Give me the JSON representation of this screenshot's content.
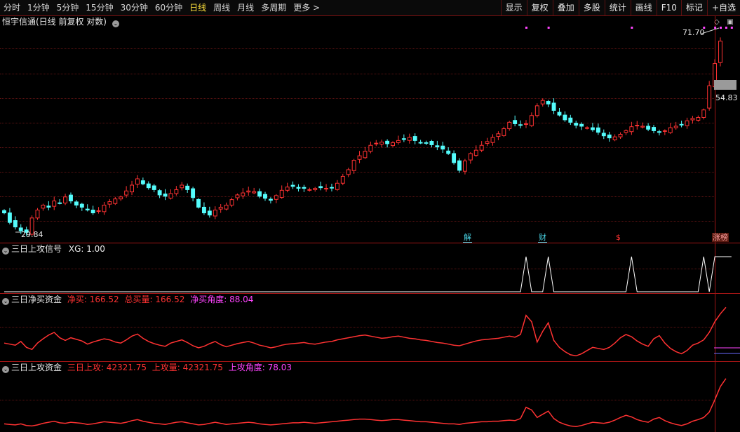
{
  "toolbar": {
    "periods": [
      {
        "label": "分时",
        "active": false
      },
      {
        "label": "1分钟",
        "active": false
      },
      {
        "label": "5分钟",
        "active": false
      },
      {
        "label": "15分钟",
        "active": false
      },
      {
        "label": "30分钟",
        "active": false
      },
      {
        "label": "60分钟",
        "active": false
      },
      {
        "label": "日线",
        "active": true
      },
      {
        "label": "周线",
        "active": false
      },
      {
        "label": "月线",
        "active": false
      },
      {
        "label": "多周期",
        "active": false
      },
      {
        "label": "更多 >",
        "active": false
      }
    ],
    "tools": [
      "显示",
      "复权",
      "叠加",
      "多股",
      "统计",
      "画线",
      "F10",
      "标记",
      "+自选"
    ]
  },
  "main": {
    "title": "恒宇信通(日线 前复权 对数)",
    "high_label": "71.70",
    "low_label": "29.84",
    "last_price": "54.83",
    "event_badges": [
      {
        "text": "解",
        "color": "#48d0e0"
      },
      {
        "text": "财",
        "color": "#48d0e0"
      },
      {
        "text": "$",
        "color": "#ff3232"
      },
      {
        "text": "涨榜",
        "color": "#ffa0a0"
      }
    ]
  },
  "panel1": {
    "name": "三日上攻信号",
    "items": [
      {
        "label": "XG: 1.00",
        "color": "#e8e8e8"
      }
    ]
  },
  "panel2": {
    "name": "三日净买资金",
    "items": [
      {
        "label": "净买: 166.52",
        "color": "#ff3232"
      },
      {
        "label": "总买量: 166.52",
        "color": "#ff3232"
      },
      {
        "label": "净买角度: 88.04",
        "color": "#ff44ff"
      }
    ]
  },
  "panel3": {
    "name": "三日上攻资金",
    "items": [
      {
        "label": "三日上攻: 42321.75",
        "color": "#ff3232"
      },
      {
        "label": "上攻量: 42321.75",
        "color": "#ff3232"
      },
      {
        "label": "上攻角度: 78.03",
        "color": "#ff44ff"
      }
    ]
  },
  "colors": {
    "up": "#ff3232",
    "down": "#54fcfc",
    "grid": "#5a1212",
    "signal": "#ffffff",
    "marker": "#ff44ff"
  },
  "chart_data": {
    "type": "candlestick",
    "closes": [
      32.5,
      31.2,
      30.6,
      30.1,
      29.9,
      31.8,
      32.9,
      33.6,
      33.3,
      34.2,
      33.9,
      34.8,
      34.2,
      33.6,
      33.3,
      32.9,
      32.5,
      32.8,
      33.6,
      34.1,
      34.5,
      34.8,
      35.7,
      36.6,
      37.6,
      36.8,
      36.2,
      35.9,
      35.1,
      34.9,
      35.3,
      35.9,
      36.6,
      35.9,
      34.7,
      33.3,
      32.5,
      32.2,
      32.9,
      33.3,
      33.6,
      34.4,
      35.1,
      35.4,
      35.7,
      35.6,
      34.9,
      34.6,
      34.3,
      35.0,
      35.8,
      36.3,
      36.4,
      36.1,
      36.1,
      35.9,
      36.1,
      36.2,
      36.1,
      36.2,
      36.9,
      38.0,
      39.1,
      40.7,
      41.5,
      42.3,
      43.4,
      43.8,
      44.0,
      43.7,
      43.9,
      44.3,
      44.5,
      44.9,
      44.3,
      43.9,
      43.8,
      43.5,
      43.1,
      42.7,
      41.9,
      40.3,
      39.0,
      40.6,
      41.9,
      42.5,
      43.4,
      44.1,
      44.9,
      45.6,
      46.6,
      47.9,
      47.6,
      47.3,
      47.6,
      49.3,
      51.4,
      52.6,
      51.8,
      50.4,
      49.4,
      48.4,
      47.9,
      47.3,
      47.1,
      46.8,
      46.4,
      45.9,
      45.2,
      44.8,
      45.0,
      45.5,
      46.2,
      47.0,
      47.3,
      47.1,
      46.5,
      46.2,
      45.9,
      46.2,
      46.8,
      47.1,
      47.4,
      48.2,
      48.7,
      48.9,
      50.5,
      56.0,
      61.6,
      67.8
    ],
    "ylim": [
      29.84,
      71.7
    ],
    "y_scale": "log",
    "grid": true,
    "signal_xg": [
      0,
      0,
      0,
      0,
      0,
      0,
      0,
      0,
      0,
      0,
      0,
      0,
      0,
      0,
      0,
      0,
      0,
      0,
      0,
      0,
      0,
      0,
      0,
      0,
      0,
      0,
      0,
      0,
      0,
      0,
      0,
      0,
      0,
      0,
      0,
      0,
      0,
      0,
      0,
      0,
      0,
      0,
      0,
      0,
      0,
      0,
      0,
      0,
      0,
      0,
      0,
      0,
      0,
      0,
      0,
      0,
      0,
      0,
      0,
      0,
      0,
      0,
      0,
      0,
      0,
      0,
      0,
      0,
      0,
      0,
      0,
      0,
      0,
      0,
      0,
      0,
      0,
      0,
      0,
      0,
      0,
      0,
      0,
      0,
      0,
      0,
      0,
      0,
      0,
      0,
      0,
      0,
      0,
      0,
      1,
      0,
      0,
      0,
      1,
      0,
      0,
      0,
      0,
      0,
      0,
      0,
      0,
      0,
      0,
      0,
      0,
      0,
      0,
      1,
      0,
      0,
      0,
      0,
      0,
      0,
      0,
      0,
      0,
      0,
      0,
      0,
      1,
      0,
      1,
      1,
      1,
      1
    ],
    "net_buy_series": [
      0.3,
      0.28,
      0.26,
      0.33,
      0.22,
      0.18,
      0.3,
      0.38,
      0.45,
      0.5,
      0.4,
      0.35,
      0.4,
      0.37,
      0.34,
      0.28,
      0.32,
      0.35,
      0.38,
      0.36,
      0.32,
      0.3,
      0.36,
      0.43,
      0.47,
      0.39,
      0.33,
      0.29,
      0.26,
      0.24,
      0.3,
      0.33,
      0.36,
      0.31,
      0.25,
      0.21,
      0.24,
      0.29,
      0.33,
      0.27,
      0.23,
      0.26,
      0.29,
      0.31,
      0.33,
      0.3,
      0.26,
      0.24,
      0.21,
      0.23,
      0.26,
      0.28,
      0.29,
      0.3,
      0.31,
      0.29,
      0.28,
      0.3,
      0.32,
      0.33,
      0.36,
      0.38,
      0.4,
      0.42,
      0.44,
      0.45,
      0.43,
      0.41,
      0.39,
      0.4,
      0.42,
      0.43,
      0.41,
      0.39,
      0.38,
      0.36,
      0.35,
      0.33,
      0.31,
      0.3,
      0.28,
      0.26,
      0.25,
      0.28,
      0.31,
      0.34,
      0.36,
      0.37,
      0.38,
      0.39,
      0.41,
      0.43,
      0.41,
      0.46,
      0.82,
      0.7,
      0.32,
      0.52,
      0.68,
      0.35,
      0.22,
      0.14,
      0.08,
      0.06,
      0.1,
      0.16,
      0.22,
      0.2,
      0.18,
      0.22,
      0.3,
      0.4,
      0.46,
      0.42,
      0.34,
      0.28,
      0.24,
      0.38,
      0.44,
      0.3,
      0.2,
      0.14,
      0.1,
      0.16,
      0.26,
      0.3,
      0.36,
      0.5,
      0.7,
      0.85,
      0.97
    ],
    "attack_series": [
      0.1,
      0.09,
      0.08,
      0.1,
      0.07,
      0.06,
      0.08,
      0.11,
      0.13,
      0.15,
      0.12,
      0.11,
      0.13,
      0.12,
      0.11,
      0.09,
      0.1,
      0.12,
      0.14,
      0.13,
      0.12,
      0.11,
      0.13,
      0.16,
      0.18,
      0.15,
      0.13,
      0.11,
      0.1,
      0.09,
      0.11,
      0.13,
      0.14,
      0.12,
      0.1,
      0.08,
      0.09,
      0.11,
      0.13,
      0.11,
      0.09,
      0.1,
      0.11,
      0.12,
      0.13,
      0.12,
      0.1,
      0.09,
      0.08,
      0.09,
      0.1,
      0.11,
      0.12,
      0.12,
      0.13,
      0.12,
      0.11,
      0.12,
      0.13,
      0.14,
      0.15,
      0.16,
      0.17,
      0.18,
      0.19,
      0.19,
      0.18,
      0.17,
      0.16,
      0.17,
      0.18,
      0.18,
      0.17,
      0.16,
      0.15,
      0.14,
      0.14,
      0.13,
      0.12,
      0.11,
      0.1,
      0.1,
      0.09,
      0.11,
      0.12,
      0.13,
      0.14,
      0.14,
      0.15,
      0.15,
      0.16,
      0.17,
      0.16,
      0.2,
      0.41,
      0.36,
      0.22,
      0.28,
      0.34,
      0.2,
      0.13,
      0.09,
      0.06,
      0.05,
      0.07,
      0.1,
      0.13,
      0.12,
      0.11,
      0.13,
      0.17,
      0.22,
      0.26,
      0.23,
      0.18,
      0.15,
      0.13,
      0.19,
      0.22,
      0.16,
      0.12,
      0.09,
      0.07,
      0.1,
      0.15,
      0.18,
      0.22,
      0.32,
      0.55,
      0.8,
      0.95
    ]
  }
}
